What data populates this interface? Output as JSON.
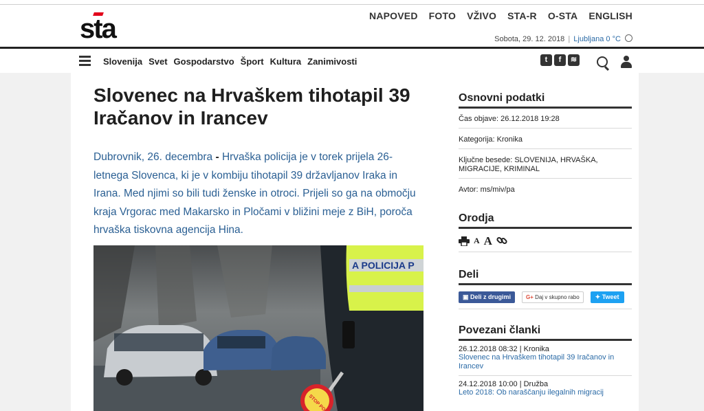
{
  "logo": {
    "text": "sta"
  },
  "topnav": [
    "NAPOVED",
    "FOTO",
    "VŽIVO",
    "STA-R",
    "O-STA",
    "ENGLISH"
  ],
  "dateline": {
    "date": "Sobota, 29. 12. 2018",
    "separator": "|",
    "city": "Ljubljana",
    "temp": "0 °C",
    "weather_icon": "sun-icon"
  },
  "mainnav": [
    "Slovenija",
    "Svet",
    "Gospodarstvo",
    "Šport",
    "Kultura",
    "Zanimivosti"
  ],
  "social_icons": [
    "twitter-icon",
    "facebook-icon",
    "rss-icon"
  ],
  "social_glyphs": {
    "twitter": "t",
    "facebook": "f",
    "rss": "≋"
  },
  "article": {
    "title": "Slovenec na Hrvaškem tihotapil 39 Iračanov in Irancev",
    "place": "Dubrovnik, 26. decembra",
    "dash": " - ",
    "lead_body": "Hrvaška policija je v torek prijela 26-letnega Slovenca, ki je v kombiju tihotapil 39 državljanov Iraka in Irana. Med njimi so bili tudi ženske in otroci. Prijeli so ga na območju kraja Vrgorac med Makarsko in Pločami v bližini meje z BiH, poroča hrvaška tiskovna agencija Hina.",
    "photo_text": {
      "vest": "A POLICIJA P",
      "paddle": "STOP POLICIJA"
    }
  },
  "sidebar": {
    "basics_title": "Osnovni podatki",
    "published": "Čas objave: 26.12.2018 19:28",
    "category": "Kategorija: Kronika",
    "keywords": "Ključne besede: SLOVENIJA, HRVAŠKA, MIGRACIJE, KRIMINAL",
    "author": "Avtor: ms/miv/pa",
    "tools_title": "Orodja",
    "tools": {
      "small_a": "A",
      "big_a": "A"
    },
    "share_title": "Deli",
    "share": {
      "facebook": "Deli z drugimi",
      "google": "Daj v skupno rabo",
      "google_glyph": "G+",
      "twitter": "Tweet"
    },
    "related_title": "Povezani članki",
    "related": [
      {
        "meta": "26.12.2018 08:32 | Kronika",
        "title": "Slovenec na Hrvaškem tihotapil 39 Iračanov in Irancev"
      },
      {
        "meta": "24.12.2018 10:00 | Družba",
        "title": "Leto 2018: Ob naraščanju ilegalnih migracij"
      }
    ]
  },
  "colors": {
    "link_blue": "#2a6aa6",
    "lead_blue": "#2a5f93",
    "brand_red": "#e2001a",
    "facebook": "#3b5998",
    "twitter": "#1da1f2"
  }
}
